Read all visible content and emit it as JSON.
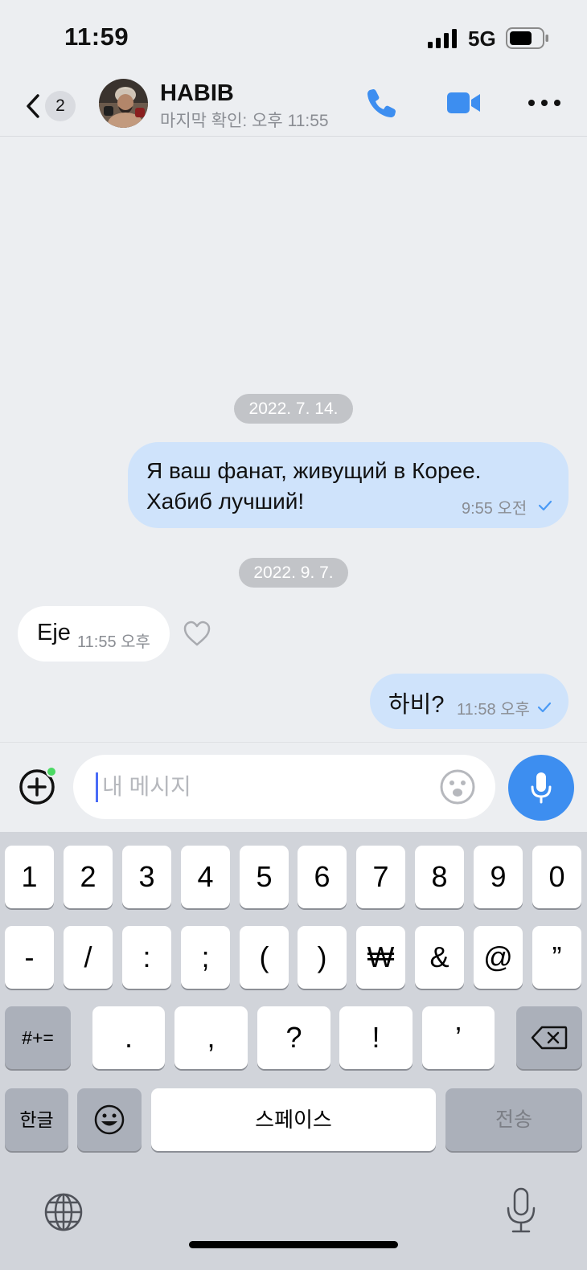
{
  "status_bar": {
    "time": "11:59",
    "network": "5G",
    "icons": [
      "signal-icon",
      "battery-icon"
    ]
  },
  "header": {
    "back_badge": "2",
    "contact_name": "HABIB",
    "last_seen": "마지막 확인: 오후 11:55",
    "icons": [
      "back-chevron-icon",
      "avatar-photo",
      "phone-icon",
      "video-camera-icon",
      "more-dots-icon"
    ],
    "accent_color": "#3d8ef0"
  },
  "messages": [
    {
      "type": "date",
      "text": "2022. 7. 14."
    },
    {
      "type": "outgoing",
      "lines": [
        "Я ваш фанат, живущий в Корее.",
        "Хабиб лучший!"
      ],
      "time": "9:55 오전",
      "read": true
    },
    {
      "type": "date",
      "text": "2022. 9. 7."
    },
    {
      "type": "incoming",
      "text": "Eje",
      "time": "11:55 오후"
    },
    {
      "type": "outgoing",
      "text": "하비?",
      "time": "11:58 오후",
      "read": true
    }
  ],
  "composer": {
    "placeholder": "내 메시지",
    "icons": [
      "attach-plus-icon",
      "emoji-face-icon",
      "microphone-icon"
    ]
  },
  "keyboard": {
    "row1": [
      "1",
      "2",
      "3",
      "4",
      "5",
      "6",
      "7",
      "8",
      "9",
      "0"
    ],
    "row2": [
      "-",
      "/",
      ":",
      ";",
      "(",
      ")",
      "₩",
      "&",
      "@",
      "”"
    ],
    "row3": [
      "#+=",
      ".",
      ",",
      "?",
      "!",
      "’"
    ],
    "row4": [
      "한글",
      "스페이스",
      "전송"
    ],
    "icons": [
      "backspace-icon",
      "emoji-key-icon",
      "globe-icon",
      "dictation-mic-icon"
    ]
  }
}
